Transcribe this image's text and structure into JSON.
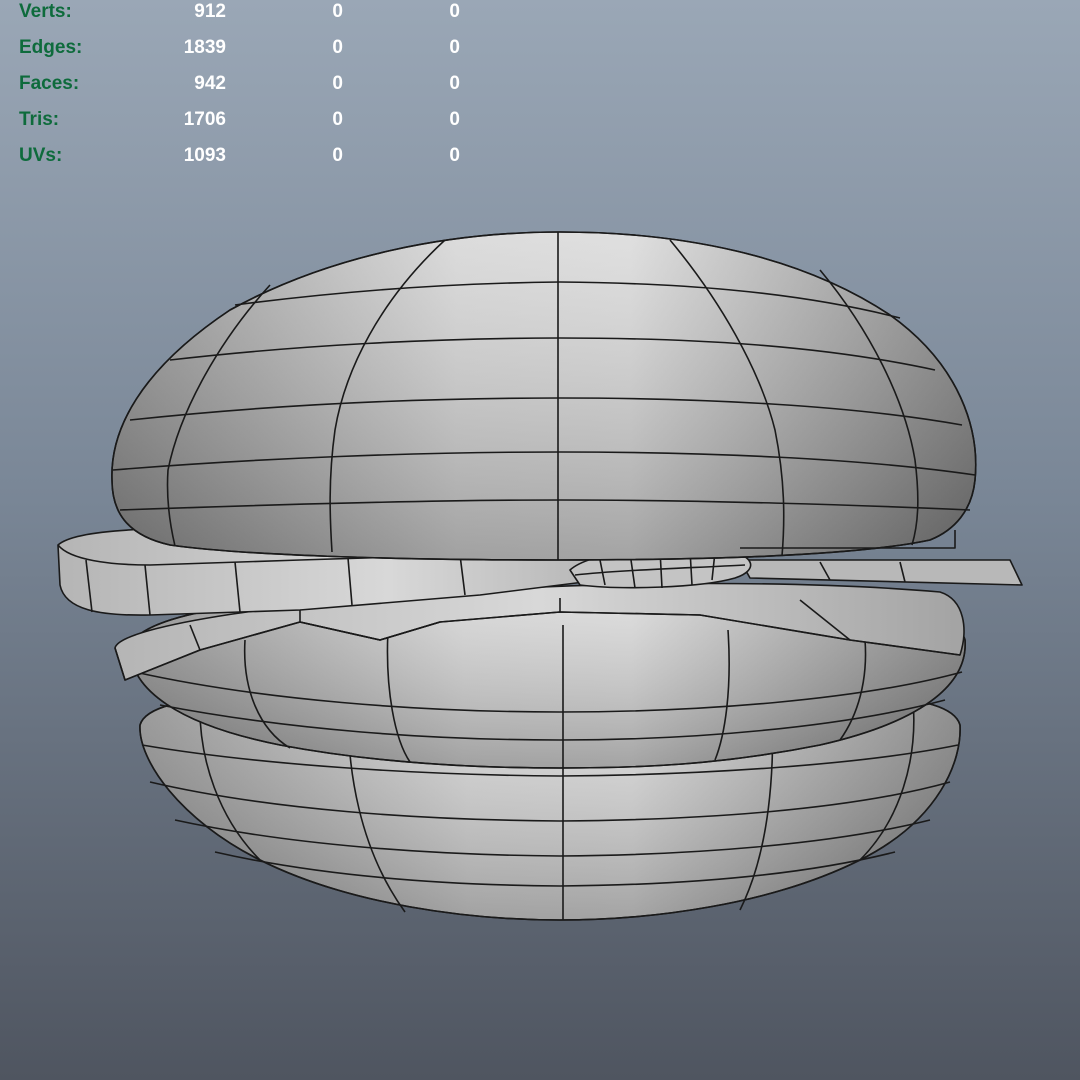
{
  "hud": {
    "rows": [
      {
        "label": "Verts:",
        "v1": "912",
        "v2": "0",
        "v3": "0"
      },
      {
        "label": "Edges:",
        "v1": "1839",
        "v2": "0",
        "v3": "0"
      },
      {
        "label": "Faces:",
        "v1": "942",
        "v2": "0",
        "v3": "0"
      },
      {
        "label": "Tris:",
        "v1": "1706",
        "v2": "0",
        "v3": "0"
      },
      {
        "label": "UVs:",
        "v1": "1093",
        "v2": "0",
        "v3": "0"
      }
    ]
  },
  "colors": {
    "label": "#0e6b3c",
    "value": "#ffffff",
    "mesh_fill": "#c9c9c9",
    "mesh_edge": "#1a1a1a"
  },
  "model": {
    "icon": "hamburger-mesh"
  }
}
